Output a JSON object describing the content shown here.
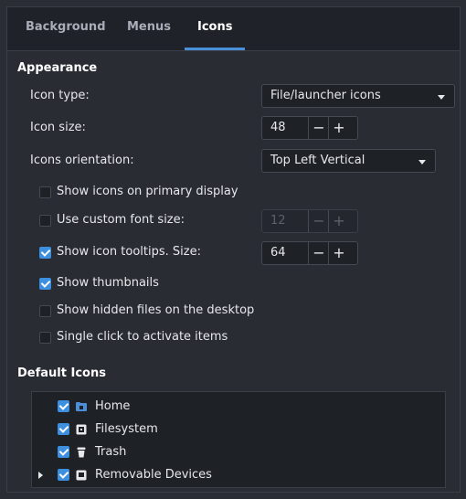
{
  "tabs": [
    {
      "label": "Background",
      "active": false
    },
    {
      "label": "Menus",
      "active": false
    },
    {
      "label": "Icons",
      "active": true
    }
  ],
  "appearance": {
    "title": "Appearance",
    "icon_type": {
      "label": "Icon type:",
      "value": "File/launcher icons"
    },
    "icon_size": {
      "label": "Icon size:",
      "value": "48",
      "minus": "−",
      "plus": "+"
    },
    "orientation": {
      "label": "Icons orientation:",
      "value": "Top Left Vertical"
    },
    "show_primary": {
      "label": "Show icons on primary display",
      "checked": false
    },
    "custom_font": {
      "label": "Use custom font size:",
      "checked": false,
      "value": "12",
      "minus": "−",
      "plus": "+"
    },
    "tooltips": {
      "label": "Show icon tooltips. Size:",
      "checked": true,
      "value": "64",
      "minus": "−",
      "plus": "+"
    },
    "thumbnails": {
      "label": "Show thumbnails",
      "checked": true
    },
    "hidden_files": {
      "label": "Show hidden files on the desktop",
      "checked": false
    },
    "single_click": {
      "label": "Single click to activate items",
      "checked": false
    }
  },
  "default_icons": {
    "title": "Default Icons",
    "items": [
      {
        "label": "Home",
        "checked": true,
        "icon": "folder-home-icon"
      },
      {
        "label": "Filesystem",
        "checked": true,
        "icon": "drive-icon"
      },
      {
        "label": "Trash",
        "checked": true,
        "icon": "trash-icon"
      },
      {
        "label": "Removable Devices",
        "checked": true,
        "icon": "removable-drive-icon",
        "expandable": true
      }
    ]
  },
  "colors": {
    "accent": "#3d8fe0",
    "background": "#292c33"
  }
}
